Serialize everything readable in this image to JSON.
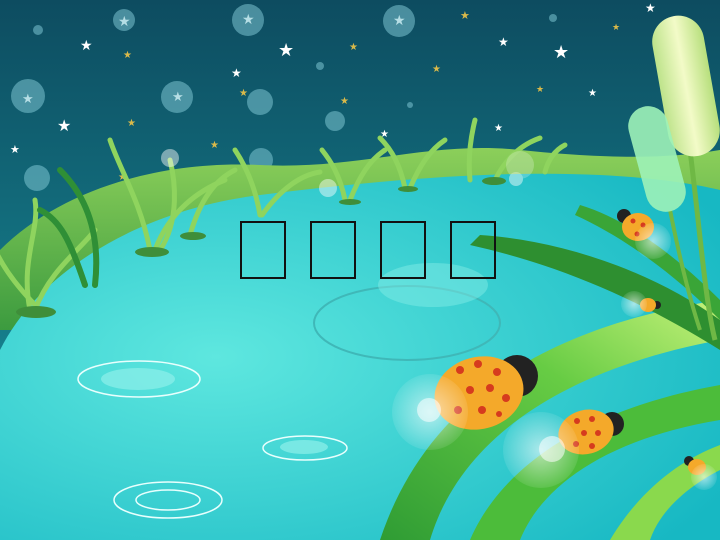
{
  "title": {
    "glyphs": [
      "",
      "",
      "",
      ""
    ]
  },
  "scene": {
    "colors": {
      "sky_top": "#0e4f63",
      "sky_bottom": "#1b95a0",
      "hill": "#4fae4a",
      "water": "#34d1cc",
      "water_light": "#6fe8e0",
      "leaf": "#3fb23a",
      "leaf_light": "#9be35d",
      "ladybug": "#f4a92a",
      "ladybug_spot": "#d63b1e",
      "cattail": "#e4f3a0"
    }
  }
}
